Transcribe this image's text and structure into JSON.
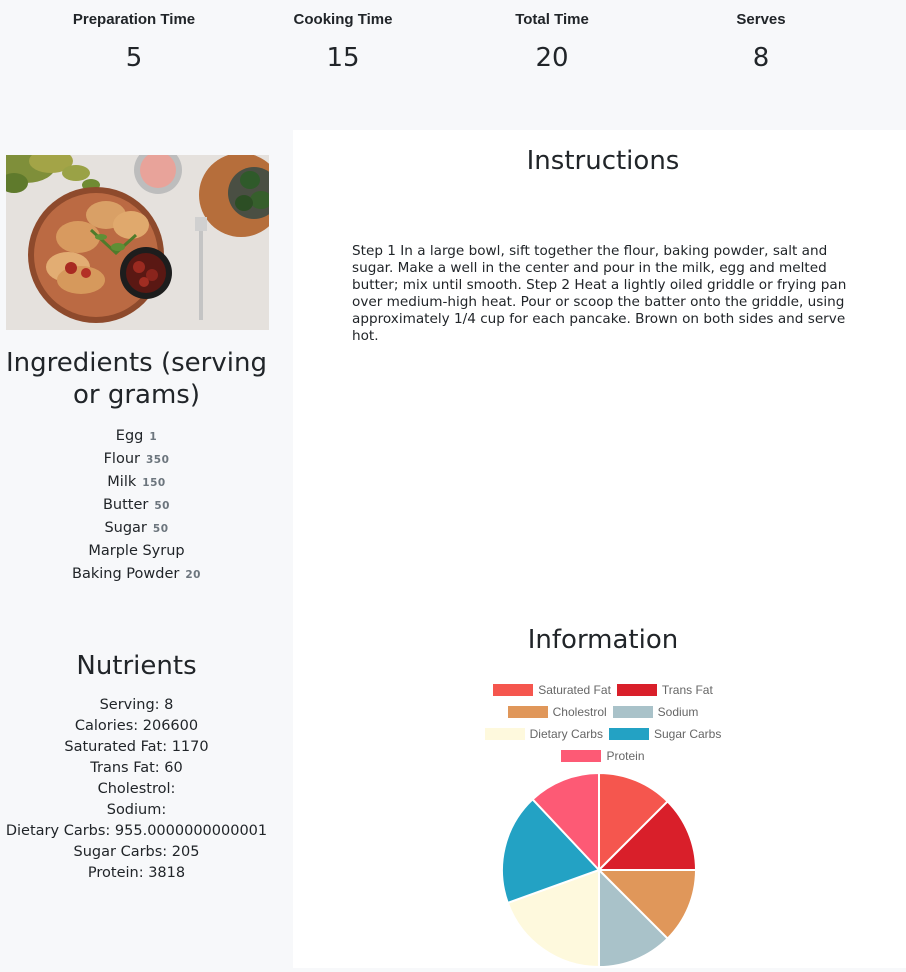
{
  "stats": [
    {
      "label": "Preparation Time",
      "value": "5"
    },
    {
      "label": "Cooking Time",
      "value": "15"
    },
    {
      "label": "Total Time",
      "value": "20"
    },
    {
      "label": "Serves",
      "value": "8"
    }
  ],
  "ingredients": {
    "title": "Ingredients (serving or grams)",
    "items": [
      {
        "name": "Egg",
        "qty": "1"
      },
      {
        "name": "Flour",
        "qty": "350"
      },
      {
        "name": "Milk",
        "qty": "150"
      },
      {
        "name": "Butter",
        "qty": "50"
      },
      {
        "name": "Sugar",
        "qty": "50"
      },
      {
        "name": "Marple Syrup",
        "qty": ""
      },
      {
        "name": "Baking Powder",
        "qty": "20"
      }
    ]
  },
  "nutrients": {
    "title": "Nutrients",
    "items": [
      "Serving: 8",
      "Calories: 206600",
      "Saturated Fat: 1170",
      "Trans Fat: 60",
      "Cholestrol:",
      "Sodium:",
      "Dietary Carbs: 955.0000000000001",
      "Sugar Carbs: 205",
      "Protein: 3818"
    ]
  },
  "instructions": {
    "title": "Instructions",
    "text": "Step 1 In a large bowl, sift together the flour, baking powder, salt and sugar. Make a well in the center and pour in the milk, egg and melted butter; mix until smooth. Step 2 Heat a lightly oiled griddle or frying pan over medium-high heat. Pour or scoop the batter onto the griddle, using approximately 1/4 cup for each pancake. Brown on both sides and serve hot."
  },
  "information": {
    "title": "Information",
    "legend_rows": [
      [
        0,
        1
      ],
      [
        2,
        3
      ],
      [
        4,
        5
      ],
      [
        6
      ]
    ]
  },
  "chart_data": {
    "type": "pie",
    "categories": [
      "Saturated Fat",
      "Trans Fat",
      "Cholestrol",
      "Sodium",
      "Dietary Carbs",
      "Sugar Carbs",
      "Protein"
    ],
    "values": [
      12.5,
      12.5,
      12.5,
      12.5,
      19.5,
      18.5,
      12
    ],
    "colors": [
      "#f5564e",
      "#d91f2a",
      "#e0975a",
      "#a9c2c9",
      "#fef9dd",
      "#23a2c4",
      "#fd5a75"
    ],
    "legend_position": "top"
  }
}
